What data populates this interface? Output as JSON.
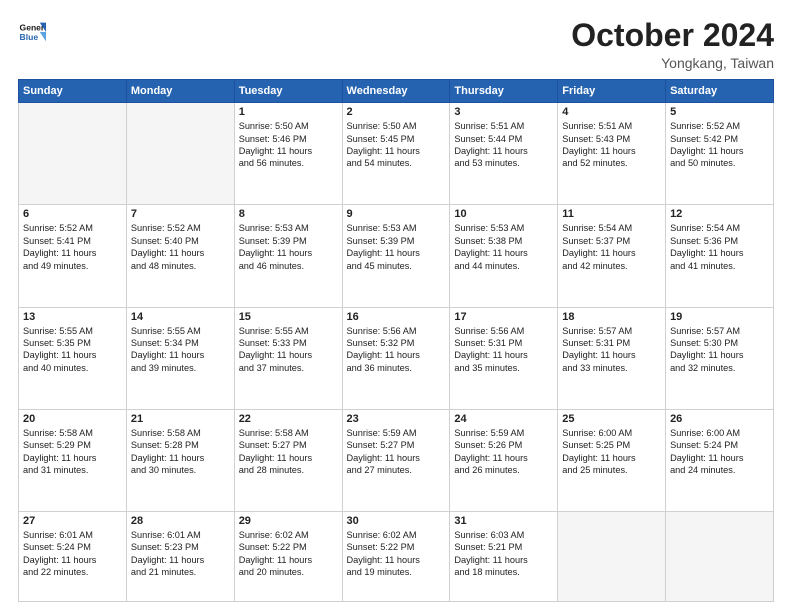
{
  "header": {
    "logo_line1": "General",
    "logo_line2": "Blue",
    "month": "October 2024",
    "location": "Yongkang, Taiwan"
  },
  "weekdays": [
    "Sunday",
    "Monday",
    "Tuesday",
    "Wednesday",
    "Thursday",
    "Friday",
    "Saturday"
  ],
  "weeks": [
    [
      {
        "day": "",
        "lines": []
      },
      {
        "day": "",
        "lines": []
      },
      {
        "day": "1",
        "lines": [
          "Sunrise: 5:50 AM",
          "Sunset: 5:46 PM",
          "Daylight: 11 hours",
          "and 56 minutes."
        ]
      },
      {
        "day": "2",
        "lines": [
          "Sunrise: 5:50 AM",
          "Sunset: 5:45 PM",
          "Daylight: 11 hours",
          "and 54 minutes."
        ]
      },
      {
        "day": "3",
        "lines": [
          "Sunrise: 5:51 AM",
          "Sunset: 5:44 PM",
          "Daylight: 11 hours",
          "and 53 minutes."
        ]
      },
      {
        "day": "4",
        "lines": [
          "Sunrise: 5:51 AM",
          "Sunset: 5:43 PM",
          "Daylight: 11 hours",
          "and 52 minutes."
        ]
      },
      {
        "day": "5",
        "lines": [
          "Sunrise: 5:52 AM",
          "Sunset: 5:42 PM",
          "Daylight: 11 hours",
          "and 50 minutes."
        ]
      }
    ],
    [
      {
        "day": "6",
        "lines": [
          "Sunrise: 5:52 AM",
          "Sunset: 5:41 PM",
          "Daylight: 11 hours",
          "and 49 minutes."
        ]
      },
      {
        "day": "7",
        "lines": [
          "Sunrise: 5:52 AM",
          "Sunset: 5:40 PM",
          "Daylight: 11 hours",
          "and 48 minutes."
        ]
      },
      {
        "day": "8",
        "lines": [
          "Sunrise: 5:53 AM",
          "Sunset: 5:39 PM",
          "Daylight: 11 hours",
          "and 46 minutes."
        ]
      },
      {
        "day": "9",
        "lines": [
          "Sunrise: 5:53 AM",
          "Sunset: 5:39 PM",
          "Daylight: 11 hours",
          "and 45 minutes."
        ]
      },
      {
        "day": "10",
        "lines": [
          "Sunrise: 5:53 AM",
          "Sunset: 5:38 PM",
          "Daylight: 11 hours",
          "and 44 minutes."
        ]
      },
      {
        "day": "11",
        "lines": [
          "Sunrise: 5:54 AM",
          "Sunset: 5:37 PM",
          "Daylight: 11 hours",
          "and 42 minutes."
        ]
      },
      {
        "day": "12",
        "lines": [
          "Sunrise: 5:54 AM",
          "Sunset: 5:36 PM",
          "Daylight: 11 hours",
          "and 41 minutes."
        ]
      }
    ],
    [
      {
        "day": "13",
        "lines": [
          "Sunrise: 5:55 AM",
          "Sunset: 5:35 PM",
          "Daylight: 11 hours",
          "and 40 minutes."
        ]
      },
      {
        "day": "14",
        "lines": [
          "Sunrise: 5:55 AM",
          "Sunset: 5:34 PM",
          "Daylight: 11 hours",
          "and 39 minutes."
        ]
      },
      {
        "day": "15",
        "lines": [
          "Sunrise: 5:55 AM",
          "Sunset: 5:33 PM",
          "Daylight: 11 hours",
          "and 37 minutes."
        ]
      },
      {
        "day": "16",
        "lines": [
          "Sunrise: 5:56 AM",
          "Sunset: 5:32 PM",
          "Daylight: 11 hours",
          "and 36 minutes."
        ]
      },
      {
        "day": "17",
        "lines": [
          "Sunrise: 5:56 AM",
          "Sunset: 5:31 PM",
          "Daylight: 11 hours",
          "and 35 minutes."
        ]
      },
      {
        "day": "18",
        "lines": [
          "Sunrise: 5:57 AM",
          "Sunset: 5:31 PM",
          "Daylight: 11 hours",
          "and 33 minutes."
        ]
      },
      {
        "day": "19",
        "lines": [
          "Sunrise: 5:57 AM",
          "Sunset: 5:30 PM",
          "Daylight: 11 hours",
          "and 32 minutes."
        ]
      }
    ],
    [
      {
        "day": "20",
        "lines": [
          "Sunrise: 5:58 AM",
          "Sunset: 5:29 PM",
          "Daylight: 11 hours",
          "and 31 minutes."
        ]
      },
      {
        "day": "21",
        "lines": [
          "Sunrise: 5:58 AM",
          "Sunset: 5:28 PM",
          "Daylight: 11 hours",
          "and 30 minutes."
        ]
      },
      {
        "day": "22",
        "lines": [
          "Sunrise: 5:58 AM",
          "Sunset: 5:27 PM",
          "Daylight: 11 hours",
          "and 28 minutes."
        ]
      },
      {
        "day": "23",
        "lines": [
          "Sunrise: 5:59 AM",
          "Sunset: 5:27 PM",
          "Daylight: 11 hours",
          "and 27 minutes."
        ]
      },
      {
        "day": "24",
        "lines": [
          "Sunrise: 5:59 AM",
          "Sunset: 5:26 PM",
          "Daylight: 11 hours",
          "and 26 minutes."
        ]
      },
      {
        "day": "25",
        "lines": [
          "Sunrise: 6:00 AM",
          "Sunset: 5:25 PM",
          "Daylight: 11 hours",
          "and 25 minutes."
        ]
      },
      {
        "day": "26",
        "lines": [
          "Sunrise: 6:00 AM",
          "Sunset: 5:24 PM",
          "Daylight: 11 hours",
          "and 24 minutes."
        ]
      }
    ],
    [
      {
        "day": "27",
        "lines": [
          "Sunrise: 6:01 AM",
          "Sunset: 5:24 PM",
          "Daylight: 11 hours",
          "and 22 minutes."
        ]
      },
      {
        "day": "28",
        "lines": [
          "Sunrise: 6:01 AM",
          "Sunset: 5:23 PM",
          "Daylight: 11 hours",
          "and 21 minutes."
        ]
      },
      {
        "day": "29",
        "lines": [
          "Sunrise: 6:02 AM",
          "Sunset: 5:22 PM",
          "Daylight: 11 hours",
          "and 20 minutes."
        ]
      },
      {
        "day": "30",
        "lines": [
          "Sunrise: 6:02 AM",
          "Sunset: 5:22 PM",
          "Daylight: 11 hours",
          "and 19 minutes."
        ]
      },
      {
        "day": "31",
        "lines": [
          "Sunrise: 6:03 AM",
          "Sunset: 5:21 PM",
          "Daylight: 11 hours",
          "and 18 minutes."
        ]
      },
      {
        "day": "",
        "lines": []
      },
      {
        "day": "",
        "lines": []
      }
    ]
  ]
}
